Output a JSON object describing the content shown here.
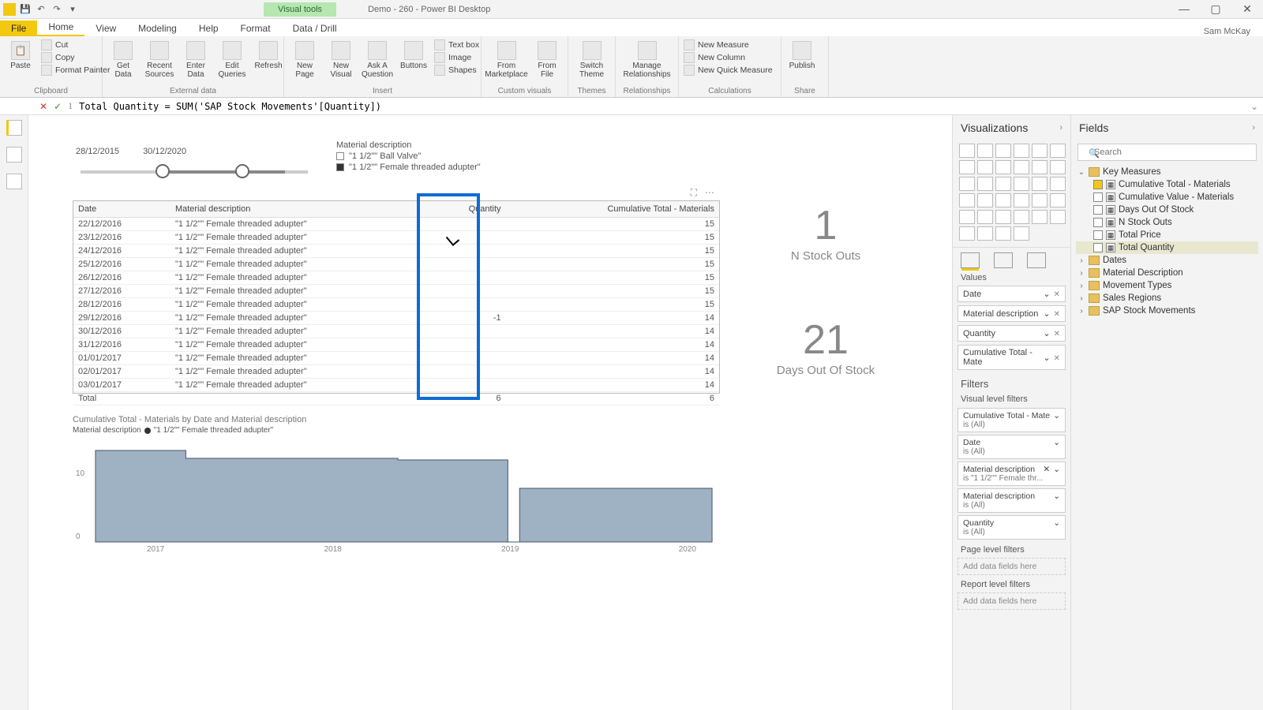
{
  "titlebar": {
    "visual_tools": "Visual tools",
    "title": "Demo - 260 - Power BI Desktop"
  },
  "tabs": {
    "file": "File",
    "home": "Home",
    "view": "View",
    "modeling": "Modeling",
    "help": "Help",
    "format": "Format",
    "datadrill": "Data / Drill",
    "user": "Sam McKay"
  },
  "ribbon": {
    "clipboard": {
      "label": "Clipboard",
      "paste": "Paste",
      "cut": "Cut",
      "copy": "Copy",
      "fp": "Format Painter"
    },
    "external": {
      "label": "External data",
      "get": "Get Data",
      "recent": "Recent Sources",
      "enter": "Enter Data",
      "edit": "Edit Queries",
      "refresh": "Refresh"
    },
    "insert": {
      "label": "Insert",
      "page": "New Page",
      "visual": "New Visual",
      "ask": "Ask A Question",
      "buttons": "Buttons",
      "text": "Text box",
      "image": "Image",
      "shapes": "Shapes"
    },
    "custom": {
      "label": "Custom visuals",
      "market": "From Marketplace",
      "file": "From File"
    },
    "themes": {
      "label": "Themes",
      "switch": "Switch Theme"
    },
    "rel": {
      "label": "Relationships",
      "manage": "Manage Relationships"
    },
    "calc": {
      "label": "Calculations",
      "nm": "New Measure",
      "nc": "New Column",
      "nq": "New Quick Measure"
    },
    "share": {
      "label": "Share",
      "publish": "Publish"
    }
  },
  "formula": {
    "line": "1",
    "text": "Total Quantity = SUM('SAP Stock Movements'[Quantity])"
  },
  "panes": {
    "viz_title": "Visualizations",
    "fields_title": "Fields",
    "values": "Values",
    "filters": "Filters",
    "vlf": "Visual level filters",
    "plf": "Page level filters",
    "rlf": "Report level filters",
    "add": "Add data fields here",
    "search_ph": "Search"
  },
  "wells": {
    "date": "Date",
    "matdesc": "Material description",
    "qty": "Quantity",
    "cum": "Cumulative Total - Mate"
  },
  "filters_list": [
    {
      "name": "Cumulative Total - Mate",
      "sub": "is (All)",
      "x": false
    },
    {
      "name": "Date",
      "sub": "is (All)",
      "x": false
    },
    {
      "name": "Material description",
      "sub": "is \"1 1/2\"\" Female thr...",
      "x": true
    },
    {
      "name": "Material description",
      "sub": "is (All)",
      "x": false
    },
    {
      "name": "Quantity",
      "sub": "is (All)",
      "x": false
    }
  ],
  "field_tables": {
    "key": {
      "name": "Key Measures",
      "fields": [
        {
          "name": "Cumulative Total - Materials",
          "checked": true
        },
        {
          "name": "Cumulative Value - Materials",
          "checked": false
        },
        {
          "name": "Days Out Of Stock",
          "checked": false
        },
        {
          "name": "N Stock Outs",
          "checked": false
        },
        {
          "name": "Total Price",
          "checked": false
        },
        {
          "name": "Total Quantity",
          "checked": false,
          "hl": true
        }
      ]
    },
    "others": [
      "Dates",
      "Material Description",
      "Movement Types",
      "Sales Regions",
      "SAP Stock Movements"
    ]
  },
  "canvas": {
    "slicer": {
      "from": "28/12/2015",
      "to": "30/12/2020"
    },
    "legend": {
      "title": "Material description",
      "items": [
        "\"1 1/2\"\" Ball Valve\"",
        "\"1 1/2\"\" Female threaded adupter\""
      ]
    },
    "table": {
      "cols": [
        "Date",
        "Material description",
        "Quantity",
        "Cumulative Total - Materials"
      ],
      "rows": [
        [
          "22/12/2016",
          "\"1 1/2\"\" Female threaded adupter\"",
          "",
          "15"
        ],
        [
          "23/12/2016",
          "\"1 1/2\"\" Female threaded adupter\"",
          "",
          "15"
        ],
        [
          "24/12/2016",
          "\"1 1/2\"\" Female threaded adupter\"",
          "",
          "15"
        ],
        [
          "25/12/2016",
          "\"1 1/2\"\" Female threaded adupter\"",
          "",
          "15"
        ],
        [
          "26/12/2016",
          "\"1 1/2\"\" Female threaded adupter\"",
          "",
          "15"
        ],
        [
          "27/12/2016",
          "\"1 1/2\"\" Female threaded adupter\"",
          "",
          "15"
        ],
        [
          "28/12/2016",
          "\"1 1/2\"\" Female threaded adupter\"",
          "",
          "15"
        ],
        [
          "29/12/2016",
          "\"1 1/2\"\" Female threaded adupter\"",
          "-1",
          "14"
        ],
        [
          "30/12/2016",
          "\"1 1/2\"\" Female threaded adupter\"",
          "",
          "14"
        ],
        [
          "31/12/2016",
          "\"1 1/2\"\" Female threaded adupter\"",
          "",
          "14"
        ],
        [
          "01/01/2017",
          "\"1 1/2\"\" Female threaded adupter\"",
          "",
          "14"
        ],
        [
          "02/01/2017",
          "\"1 1/2\"\" Female threaded adupter\"",
          "",
          "14"
        ],
        [
          "03/01/2017",
          "\"1 1/2\"\" Female threaded adupter\"",
          "",
          "14"
        ]
      ],
      "total": [
        "Total",
        "",
        "6",
        "6"
      ]
    },
    "card1": {
      "val": "1",
      "lbl": "N Stock Outs"
    },
    "card2": {
      "val": "21",
      "lbl": "Days Out Of Stock"
    },
    "area": {
      "title": "Cumulative Total - Materials by Date and Material description",
      "legend_label": "Material description",
      "legend_item": "\"1 1/2\"\" Female threaded adupter\"",
      "yticks": [
        "10",
        "0"
      ],
      "xticks": [
        "2017",
        "2018",
        "2019",
        "2020"
      ]
    }
  },
  "chart_data": {
    "type": "area",
    "title": "Cumulative Total - Materials by Date and Material description",
    "xlabel": "Date",
    "ylabel": "Cumulative Total - Materials",
    "ylim": [
      0,
      16
    ],
    "series": [
      {
        "name": "\"1 1/2\"\" Female threaded adupter\"",
        "points": [
          {
            "x": "2016-07",
            "y": 15
          },
          {
            "x": "2017-01",
            "y": 14
          },
          {
            "x": "2017-06",
            "y": 14
          },
          {
            "x": "2018-01",
            "y": 14
          },
          {
            "x": "2018-07",
            "y": 14
          },
          {
            "x": "2018-12",
            "y": 0
          },
          {
            "x": "2019-01",
            "y": 8
          },
          {
            "x": "2019-06",
            "y": 8
          },
          {
            "x": "2020-01",
            "y": 8
          },
          {
            "x": "2020-10",
            "y": 8
          }
        ]
      }
    ]
  }
}
